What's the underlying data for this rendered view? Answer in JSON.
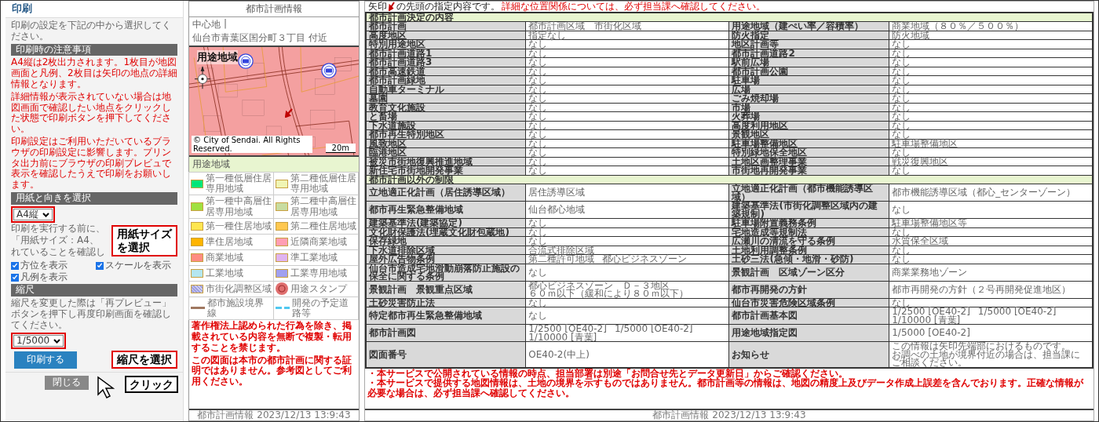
{
  "print_panel": {
    "title": "印刷",
    "intro": "印刷の設定を下記の中から選択してください。",
    "notice_header": "印刷時の注意事項",
    "notices": [
      "A4縦は2枚出力されます。1枚目が地図画面と凡例、2枚目は矢印の地点の詳細情報となります。",
      "詳細情報が表示されていない場合は地図画面で確認したい地点をクリックした状態で印刷ボタンを押下してください。",
      "印刷設定はご利用いただいているブラウザの印刷設定に影響します。プリンタ出力前にブラウザの印刷プレビュで表示を確認したうえで印刷をお願いします。"
    ],
    "paper_header": "用紙と向きを選択",
    "paper_select": "A4縦",
    "paper_hint_lines": [
      "印刷を実行する前に、",
      "「用紙サイズ：A4、",
      "れていることを確認し"
    ],
    "options": [
      {
        "label": "方位を表示",
        "checked": true
      },
      {
        "label": "スケールを表示",
        "checked": true
      },
      {
        "label": "凡例を表示",
        "checked": true
      }
    ],
    "scale_header": "縮尺",
    "scale_hint": "縮尺を変更した際は「再プレビュー」ボタンを押下し再度印刷画面を確認してください。",
    "scale_select": "1/5000",
    "print_button": "印刷する",
    "close_button": "閉じる"
  },
  "annotations": {
    "paper_callout_lines": [
      "用紙サイズ",
      "を選択"
    ],
    "scale_callout": "縮尺を選択",
    "click_label": "クリック"
  },
  "map_sheet": {
    "title": "都市計画情報",
    "location": "中心地",
    "separator": "|",
    "address": "仙台市青葉区国分町３丁目 付近",
    "map": {
      "layer_label": "用途地域",
      "copyright": "© City of Sendai. All Rights Reserved.",
      "scale_label": "20m"
    },
    "legend": {
      "title": "用途地域",
      "items": [
        {
          "label": "第一種低層住居専用地域",
          "kind": "swatch",
          "color": "#00e67a"
        },
        {
          "label": "第二種低層住居専用地域",
          "kind": "swatch",
          "color": "#f0f5b4"
        },
        {
          "label": "第一種中高層住居専用地域",
          "kind": "swatch",
          "color": "#a0e040"
        },
        {
          "label": "第二種中高層住居専用地域",
          "kind": "swatch",
          "color": "#c8dca0"
        },
        {
          "label": "第一種住居地域",
          "kind": "swatch",
          "color": "#ffe650"
        },
        {
          "label": "第二種住居地域",
          "kind": "swatch",
          "color": "#ffc850"
        },
        {
          "label": "準住居地域",
          "kind": "swatch",
          "color": "#ffb400"
        },
        {
          "label": "近隣商業地域",
          "kind": "swatch",
          "color": "#ff9eb4"
        },
        {
          "label": "商業地域",
          "kind": "swatch",
          "color": "#ff8c82"
        },
        {
          "label": "準工業地域",
          "kind": "swatch",
          "color": "#e0b4f0"
        },
        {
          "label": "工業地域",
          "kind": "swatch",
          "color": "#b4e6f0"
        },
        {
          "label": "工業専用地域",
          "kind": "swatch",
          "color": "#a0a0f0"
        },
        {
          "label": "市街化調整区域",
          "kind": "hatch",
          "color": "#a0a0e0"
        },
        {
          "label": "用途スタンプ",
          "kind": "stamp",
          "color": "#e07070"
        },
        {
          "label": "都市施設境界線",
          "kind": "line",
          "color": "#a07860"
        },
        {
          "label": "開発の予定道路等",
          "kind": "dashed",
          "color": "#50c8f0"
        }
      ]
    },
    "notes": [
      "著作権法上認められた行為を除き、掲載されている内容を無断で複製・転用することを禁じます。",
      "この図面は本市の都市計画に関する証明ではありません。参考図としてご利用ください。"
    ],
    "footer": "都市計画情報 2023/12/13 13:9:43"
  },
  "detail_sheet": {
    "intro_before": "矢印",
    "intro_after": "の先頭の指定内容です。",
    "intro_warning": "詳細な位置関係については、必ず担当課へ確認してください。",
    "sections": [
      {
        "title": "都市計画決定の内容",
        "rows": [
          [
            "都市計画",
            "都市計画区域　市街化区域",
            "用途地域（建ぺい率／容積率）",
            "商業地域（８０％／５００％）"
          ],
          [
            "高度地区",
            "指定なし",
            "防火指定",
            "防火地域"
          ],
          [
            "特別用途地区",
            "なし",
            "地区計画等",
            "なし"
          ],
          [
            "都市計画道路1",
            "なし",
            "都市計画道路2",
            "なし"
          ],
          [
            "都市計画道路3",
            "なし",
            "駅前広場",
            "なし"
          ],
          [
            "都市高速鉄道",
            "なし",
            "都市計画公園",
            "なし"
          ],
          [
            "都市計画緑地",
            "なし",
            "駐車場",
            "なし"
          ],
          [
            "自動車ターミナル",
            "なし",
            "広場",
            "なし"
          ],
          [
            "墓園",
            "なし",
            "ごみ焼却場",
            "なし"
          ],
          [
            "教育文化施設",
            "なし",
            "市場",
            "なし"
          ],
          [
            "と畜場",
            "なし",
            "火葬場",
            "なし"
          ],
          [
            "下水道施設",
            "なし",
            "高度利用地区",
            "なし"
          ],
          [
            "都市再生特別地区",
            "なし",
            "景観地区",
            "なし"
          ],
          [
            "風致地区",
            "なし",
            "駐車場整備地区",
            "駐車場整備地区"
          ],
          [
            "臨港地区",
            "なし",
            "特別緑地保全地区",
            "なし"
          ],
          [
            "被災市街地復興推進地域",
            "なし",
            "土地区画整理事業",
            "戦災復興地区"
          ],
          [
            "新住宅市街地開発事業",
            "なし",
            "市街地再開発事業",
            "なし"
          ]
        ]
      },
      {
        "title": "都市計画以外の制限",
        "rows": [
          [
            "立地適正化計画（居住誘導区域）",
            "居住誘導区域",
            "立地適正化計画（都市機能誘導区域）",
            "都市機能誘導区域（都心_センターゾーン）"
          ],
          [
            "都市再生緊急整備地域",
            "仙台都心地域",
            "建築基準法(市街化調整区域内の建築規制)",
            "なし"
          ],
          [
            "建築基準法(建築協定)",
            "なし",
            "駐車場附置義務条例",
            "駐車場整備地区等"
          ],
          [
            "文化財保護法(埋蔵文化財包蔵地)",
            "なし",
            "宅地造成等規制法",
            "なし"
          ],
          [
            "保存緑地",
            "なし",
            "広瀬川の清流を守る条例",
            "水質保全区域"
          ],
          [
            "下水道排除区域",
            "合流式排除区域",
            "土地利用調整条例",
            "なし"
          ],
          [
            "屋外広告物条例",
            [
              "第二種許可地域",
              "都心ビジネスゾーン"
            ],
            "土砂三法(急傾・地滑・砂防)",
            "なし"
          ],
          [
            "仙台市造成宅地滑動崩落防止施設の保全に関する条例",
            "なし",
            "景観計画　区域ゾーン区分",
            "商業業務地ゾーン"
          ],
          [
            "景観計画　景観重点区域",
            [
              "都心ビジネスゾーン　Ｄ－３地区",
              "６０ｍ以下（緩和により８０ｍ以下）"
            ],
            "都市再開発の方針",
            "都市再開発の方針（２号再開発促進地区）"
          ],
          [
            "土砂災害防止法",
            "なし",
            "仙台市災害危険区域条例",
            "なし"
          ],
          [
            "特定都市再生緊急整備地域",
            "なし",
            "都市計画基本図",
            [
              "1/2500 [OE40-2]",
              "1/5000 [OE40-2]",
              "1/10000 [青葉]"
            ]
          ],
          [
            "都市計画図",
            [
              "1/2500 [OE40-2]",
              "1/5000 [OE40-2]",
              "1/10000 [青葉]"
            ],
            "用途地域指定図",
            "1/5000 [OE40-2]"
          ],
          [
            "図面番号",
            "OE40-2(中上)",
            "お知らせ",
            [
              "この情報は矢印先端部におけるものです。",
              "お調べの土地が境界付近の場合は、担当課にご相談ください。"
            ]
          ]
        ]
      }
    ],
    "notes": [
      "・本サービスで公開されている情報の時点、担当部署は別途「お問合せ先とデータ更新日」からご確認ください。",
      "・本サービスで提供する地図情報は、土地の境界を示すものではありません。都市計画等の情報は、地図の精度上及びデータ作成上誤差を含んでおります。正確な情報が必要な場合は、必ず担当課へ確認してください。"
    ],
    "footer": "都市計画情報 2023/12/13 13:9:43"
  }
}
